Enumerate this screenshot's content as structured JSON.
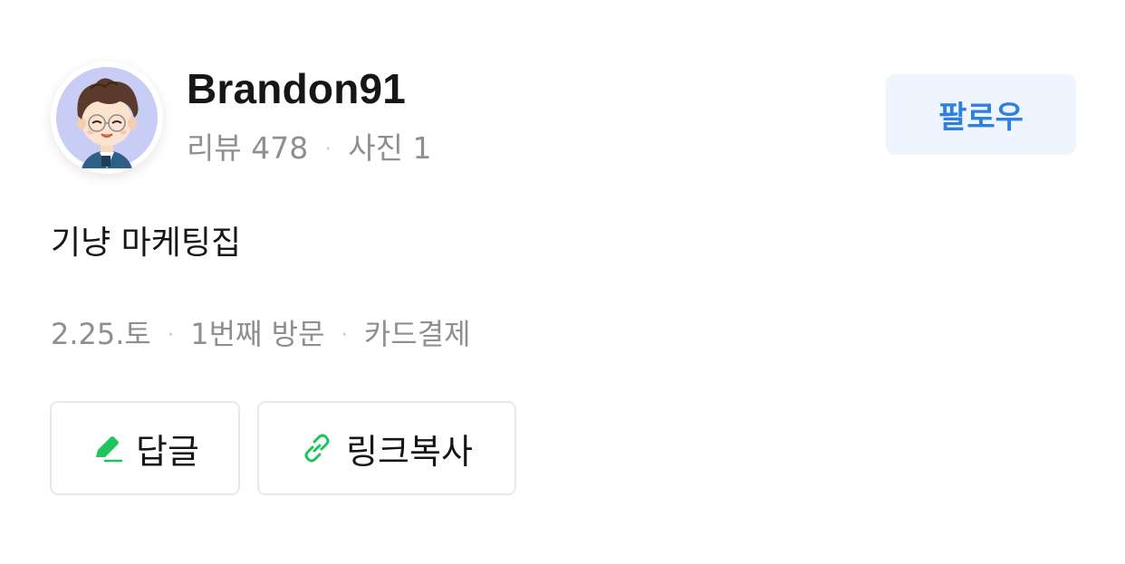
{
  "profile": {
    "username": "Brandon91",
    "review_label": "리뷰",
    "review_count": "478",
    "photo_label": "사진",
    "photo_count": "1",
    "separator": "·",
    "follow_label": "팔로우"
  },
  "review": {
    "text": "기냥 마케팅집"
  },
  "visit": {
    "date": "2.25.토",
    "visit_count": "1번째 방문",
    "payment": "카드결제",
    "separator": "·"
  },
  "actions": {
    "reply_label": "답글",
    "copy_link_label": "링크복사"
  },
  "colors": {
    "accent": "#2f7fdc",
    "follow_bg": "#eef5ff",
    "icon_green": "#1ec45c",
    "muted_text": "#8f8f8f"
  },
  "icons": {
    "reply": "pencil-icon",
    "copy_link": "link-icon"
  }
}
